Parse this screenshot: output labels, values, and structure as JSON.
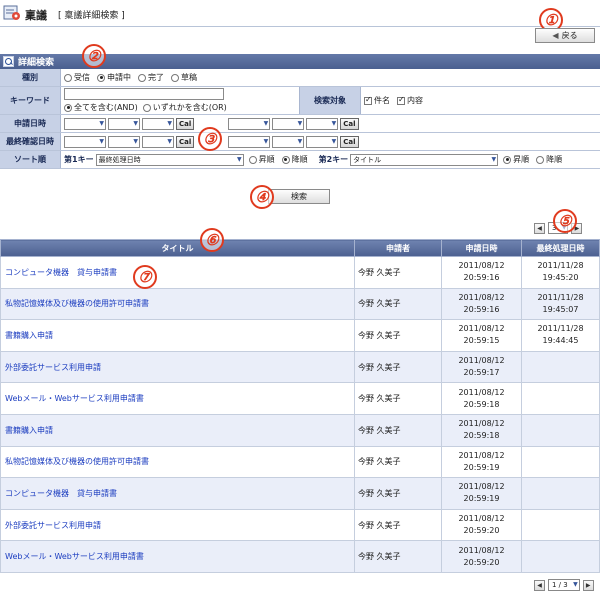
{
  "header": {
    "title": "稟議",
    "subtitle": "[ 稟議詳細検索 ]"
  },
  "back_button": "戻る",
  "callouts": [
    "①",
    "②",
    "③",
    "④",
    "⑤",
    "⑥",
    "⑦"
  ],
  "panel": {
    "title": "詳細検索",
    "type_label": "種別",
    "type_options": [
      "受信",
      "申請中",
      "完了",
      "草稿"
    ],
    "keyword_label": "キーワード",
    "keyword_value": "",
    "keyword_mode": [
      "全てを含む(AND)",
      "いずれかを含む(OR)"
    ],
    "target_label": "検索対象",
    "target_options": [
      "件名",
      "内容"
    ],
    "date1_label": "申請日時",
    "date2_label": "最終確認日時",
    "cal_label": "Cal",
    "sort_label": "ソート順",
    "key1_label": "第1キー",
    "key1_value": "最終処理日時",
    "key2_label": "第2キー",
    "key2_value": "タイトル",
    "asc": "昇順",
    "desc": "降順"
  },
  "search_button": "検索",
  "pager_top": {
    "value": "3"
  },
  "pager_bottom": {
    "value": "1 / 3"
  },
  "table": {
    "headers": [
      "タイトル",
      "申請者",
      "申請日時",
      "最終処理日時"
    ],
    "rows": [
      [
        "コンピュータ機器　貸与申請書",
        "今野 久美子",
        "2011/08/12",
        "20:59:16",
        "2011/11/28",
        "19:45:20"
      ],
      [
        "私物記憶媒体及び機器の使用許可申請書",
        "今野 久美子",
        "2011/08/12",
        "20:59:16",
        "2011/11/28",
        "19:45:07"
      ],
      [
        "書籍購入申請",
        "今野 久美子",
        "2011/08/12",
        "20:59:15",
        "2011/11/28",
        "19:44:45"
      ],
      [
        "外部委託サービス利用申請",
        "今野 久美子",
        "2011/08/12",
        "20:59:17",
        "",
        ""
      ],
      [
        "Webメール・Webサービス利用申請書",
        "今野 久美子",
        "2011/08/12",
        "20:59:18",
        "",
        ""
      ],
      [
        "書籍購入申請",
        "今野 久美子",
        "2011/08/12",
        "20:59:18",
        "",
        ""
      ],
      [
        "私物記憶媒体及び機器の使用許可申請書",
        "今野 久美子",
        "2011/08/12",
        "20:59:19",
        "",
        ""
      ],
      [
        "コンピュータ機器　貸与申請書",
        "今野 久美子",
        "2011/08/12",
        "20:59:19",
        "",
        ""
      ],
      [
        "外部委託サービス利用申請",
        "今野 久美子",
        "2011/08/12",
        "20:59:20",
        "",
        ""
      ],
      [
        "Webメール・Webサービス利用申請書",
        "今野 久美子",
        "2011/08/12",
        "20:59:20",
        "",
        ""
      ]
    ]
  },
  "colors": {
    "accent": "#4a5f8f",
    "link": "#1d3ec0",
    "callout": "#e03a1e"
  }
}
